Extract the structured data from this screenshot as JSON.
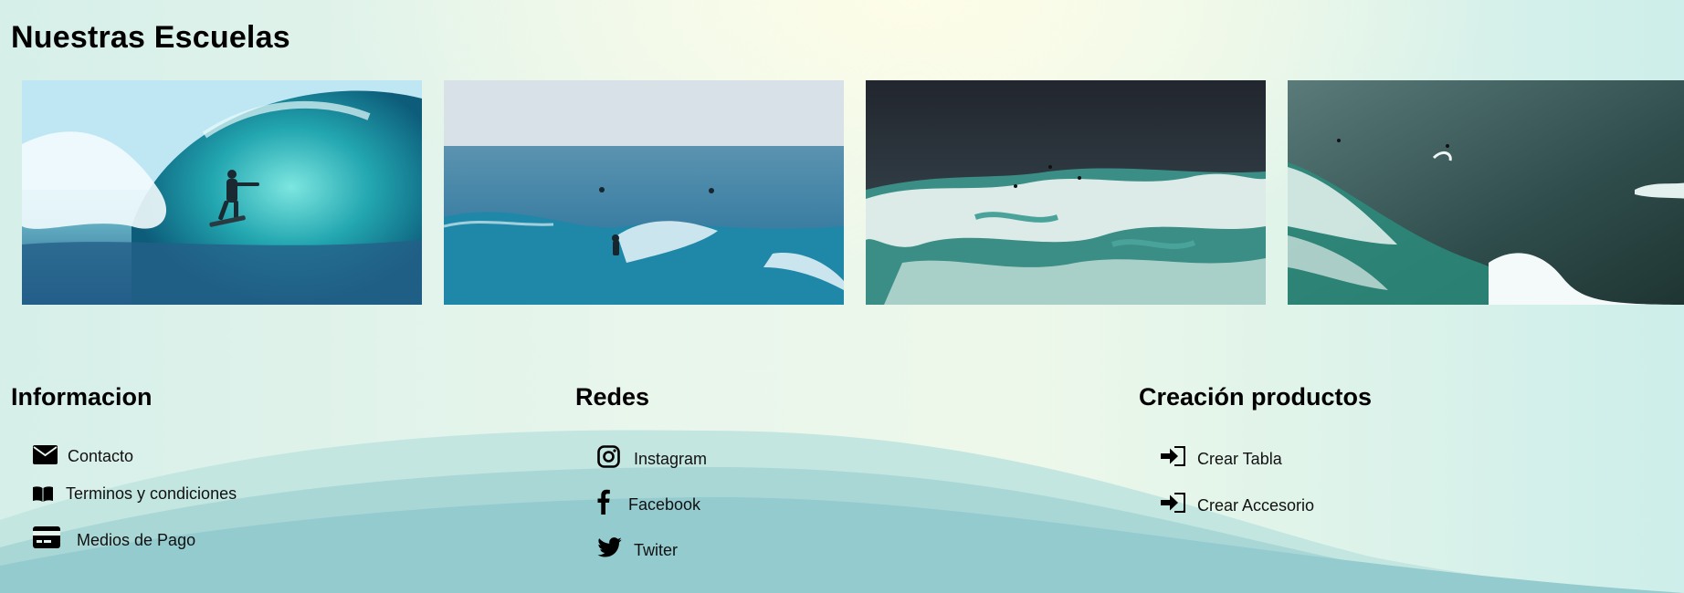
{
  "schools": {
    "title": "Nuestras Escuelas",
    "photos": [
      {
        "icon": "surfer-in-wave-tube-photo"
      },
      {
        "icon": "aerial-surfer-photo"
      },
      {
        "icon": "aerial-whitewater-photo"
      },
      {
        "icon": "aerial-ocean-wave-photo"
      }
    ]
  },
  "footer": {
    "info": {
      "title": "Informacion",
      "links": [
        {
          "label": "Contacto",
          "icon": "envelope-icon"
        },
        {
          "label": "Terminos y condiciones",
          "icon": "book-icon"
        },
        {
          "label": "Medios de Pago",
          "icon": "credit-card-icon"
        }
      ]
    },
    "redes": {
      "title": "Redes",
      "links": [
        {
          "label": "Instagram",
          "icon": "instagram-icon"
        },
        {
          "label": "Facebook",
          "icon": "facebook-icon"
        },
        {
          "label": "Twiter",
          "icon": "twitter-icon"
        }
      ]
    },
    "creacion": {
      "title": "Creación productos",
      "links": [
        {
          "label": "Crear Tabla",
          "icon": "sign-in-icon"
        },
        {
          "label": "Crear Accesorio",
          "icon": "sign-in-icon"
        }
      ]
    }
  },
  "colors": {
    "wave_light": "#bfe3df",
    "wave_mid": "#a6d4d3",
    "wave_dark": "#8fc8cc"
  }
}
